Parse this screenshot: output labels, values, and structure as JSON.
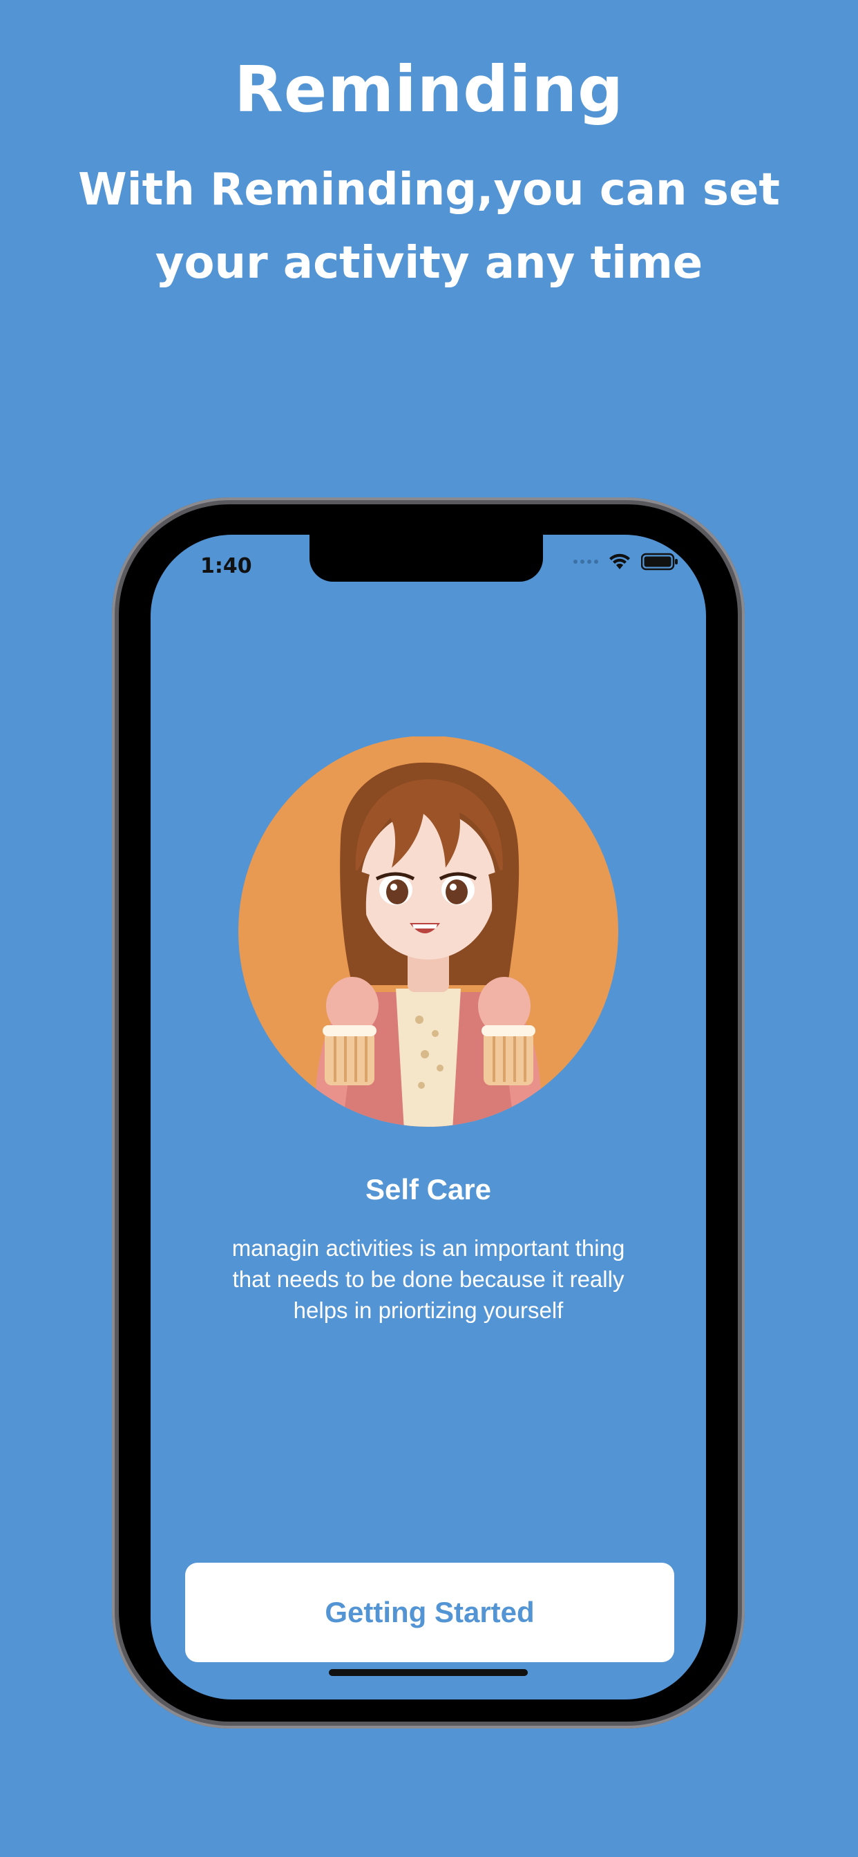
{
  "promo": {
    "title": "Reminding",
    "subtitle": "With Reminding,you can set your activity any time"
  },
  "status_bar": {
    "time": "1:40",
    "icons": [
      "signal-dots-icon",
      "wifi-icon",
      "battery-icon"
    ]
  },
  "onboarding": {
    "illustration": "girl-cheering-illustration",
    "title": "Self Care",
    "body": "managin activities is an important thing that needs to be done because it really helps in priortizing yourself",
    "button_label": "Getting Started"
  },
  "colors": {
    "background": "#5394d4",
    "circle": "#e89a52",
    "button": "#ffffff",
    "button_text": "#5394d4"
  }
}
